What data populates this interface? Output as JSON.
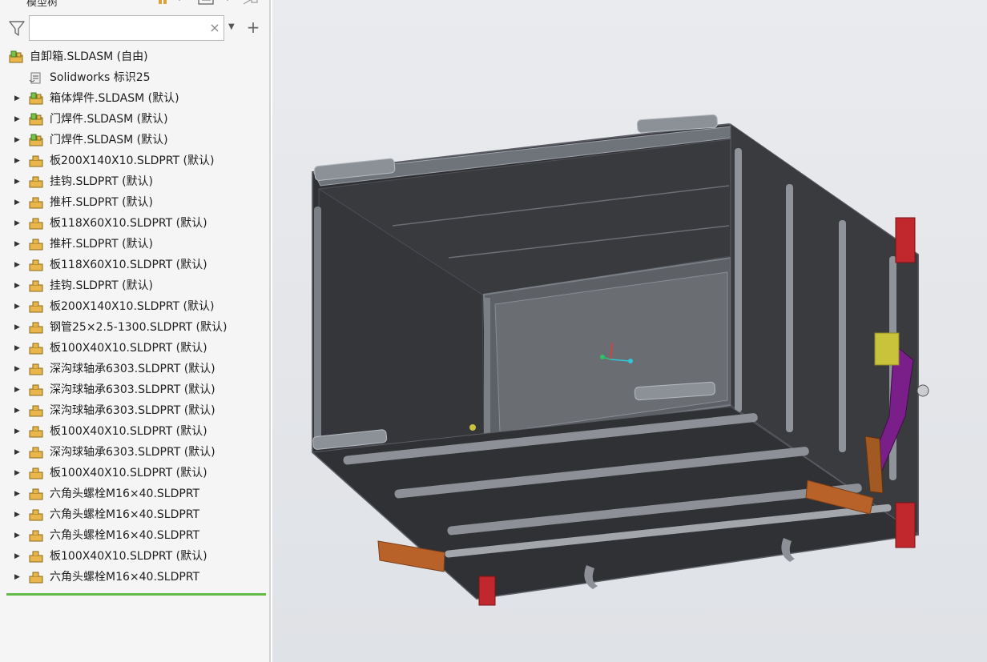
{
  "panel": {
    "title": "模型树",
    "search_value": "",
    "search_clear": "×",
    "search_dropdown": "▼",
    "search_add": "+"
  },
  "tree": {
    "expander_glyph": "▶",
    "items": [
      {
        "label": "自卸箱.SLDASM (自由)",
        "icon": "assembly-icon",
        "expandable": false,
        "indent": 0
      },
      {
        "label": "Solidworks 标识25",
        "icon": "history-icon",
        "expandable": false,
        "indent": 1
      },
      {
        "label": "箱体焊件.SLDASM (默认)",
        "icon": "assembly-icon",
        "expandable": true,
        "indent": 1
      },
      {
        "label": "门焊件.SLDASM (默认)",
        "icon": "assembly-icon",
        "expandable": true,
        "indent": 1
      },
      {
        "label": "门焊件.SLDASM (默认)",
        "icon": "assembly-icon",
        "expandable": true,
        "indent": 1
      },
      {
        "label": "板200X140X10.SLDPRT (默认)",
        "icon": "part-icon",
        "expandable": true,
        "indent": 1
      },
      {
        "label": "挂钩.SLDPRT (默认)",
        "icon": "part-icon",
        "expandable": true,
        "indent": 1
      },
      {
        "label": "推杆.SLDPRT (默认)",
        "icon": "part-icon",
        "expandable": true,
        "indent": 1
      },
      {
        "label": "板118X60X10.SLDPRT (默认)",
        "icon": "part-icon",
        "expandable": true,
        "indent": 1
      },
      {
        "label": "推杆.SLDPRT (默认)",
        "icon": "part-icon",
        "expandable": true,
        "indent": 1
      },
      {
        "label": "板118X60X10.SLDPRT (默认)",
        "icon": "part-icon",
        "expandable": true,
        "indent": 1
      },
      {
        "label": "挂钩.SLDPRT (默认)",
        "icon": "part-icon",
        "expandable": true,
        "indent": 1
      },
      {
        "label": "板200X140X10.SLDPRT (默认)",
        "icon": "part-icon",
        "expandable": true,
        "indent": 1
      },
      {
        "label": "钢管25×2.5-1300.SLDPRT (默认)",
        "icon": "part-icon",
        "expandable": true,
        "indent": 1
      },
      {
        "label": "板100X40X10.SLDPRT (默认)",
        "icon": "part-icon",
        "expandable": true,
        "indent": 1
      },
      {
        "label": "深沟球轴承6303.SLDPRT (默认)",
        "icon": "part-icon",
        "expandable": true,
        "indent": 1
      },
      {
        "label": "深沟球轴承6303.SLDPRT (默认)",
        "icon": "part-icon",
        "expandable": true,
        "indent": 1
      },
      {
        "label": "深沟球轴承6303.SLDPRT (默认)",
        "icon": "part-icon",
        "expandable": true,
        "indent": 1
      },
      {
        "label": "板100X40X10.SLDPRT (默认)",
        "icon": "part-icon",
        "expandable": true,
        "indent": 1
      },
      {
        "label": "深沟球轴承6303.SLDPRT (默认)",
        "icon": "part-icon",
        "expandable": true,
        "indent": 1
      },
      {
        "label": "板100X40X10.SLDPRT (默认)",
        "icon": "part-icon",
        "expandable": true,
        "indent": 1
      },
      {
        "label": "六角头螺栓M16×40.SLDPRT",
        "icon": "part-icon",
        "expandable": true,
        "indent": 1
      },
      {
        "label": "六角头螺栓M16×40.SLDPRT",
        "icon": "part-icon",
        "expandable": true,
        "indent": 1
      },
      {
        "label": "六角头螺栓M16×40.SLDPRT",
        "icon": "part-icon",
        "expandable": true,
        "indent": 1
      },
      {
        "label": "板100X40X10.SLDPRT (默认)",
        "icon": "part-icon",
        "expandable": true,
        "indent": 1
      },
      {
        "label": "六角头螺栓M16×40.SLDPRT",
        "icon": "part-icon",
        "expandable": true,
        "indent": 1
      }
    ]
  },
  "colors": {
    "panel_bg": "#f5f5f5",
    "tree_end_line": "#62bb46",
    "assembly_icon": "#e8b64a",
    "part_icon": "#e8b64a",
    "box_body": "#3c3d41",
    "box_edge": "#8d9096",
    "hinge_orange": "#b8622a",
    "lever_purple": "#7a1f8a",
    "pad_red": "#c0282d",
    "triad_x": "#e23b3b",
    "triad_y": "#2ec26b",
    "triad_z": "#2fc6d8"
  }
}
